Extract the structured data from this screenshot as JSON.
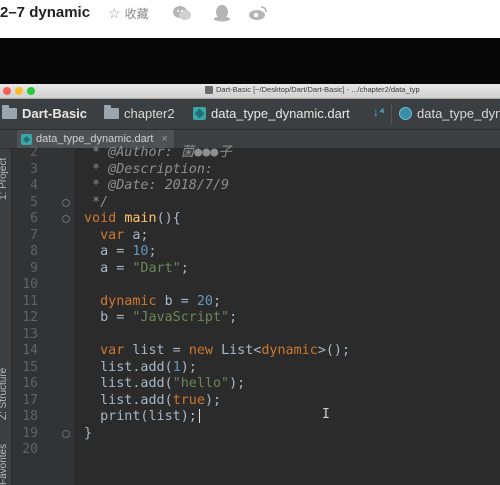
{
  "page": {
    "title": "2–7 dynamic",
    "favorite_label": "收藏",
    "share_icons": [
      "wechat-icon",
      "qq-icon",
      "weibo-icon"
    ]
  },
  "window": {
    "title": "Dart-Basic [~/Desktop/Dart/Dart-Basic] - .../chapter2/data_typ"
  },
  "navbar": {
    "project": "Dart-Basic",
    "folder": "chapter2",
    "file": "data_type_dynamic.dart",
    "symbol": "data_type_dyn"
  },
  "tab": {
    "label": "data_type_dynamic.dart",
    "close": "×"
  },
  "tool_windows": {
    "project": "1: Project",
    "structure": "Z: Structure",
    "favorites": "Favorites"
  },
  "editor": {
    "lines": [
      {
        "n": "2",
        "tokens": [
          {
            "t": " * @Author: ",
            "c": "c-comment"
          },
          {
            "t": "菌●●●子",
            "c": "c-comment"
          }
        ]
      },
      {
        "n": "3",
        "tokens": [
          {
            "t": " * @Description:",
            "c": "c-comment"
          }
        ]
      },
      {
        "n": "4",
        "tokens": [
          {
            "t": " * @Date: 2018/7/9",
            "c": "c-comment"
          }
        ]
      },
      {
        "n": "5",
        "tokens": [
          {
            "t": " */",
            "c": "c-comment"
          }
        ]
      },
      {
        "n": "6",
        "tokens": [
          {
            "t": "void ",
            "c": "c-kw"
          },
          {
            "t": "main",
            "c": "c-fn"
          },
          {
            "t": "(){",
            "c": "c-plain"
          }
        ]
      },
      {
        "n": "7",
        "tokens": [
          {
            "t": "  var ",
            "c": "c-kw"
          },
          {
            "t": "a;",
            "c": "c-plain"
          }
        ]
      },
      {
        "n": "8",
        "tokens": [
          {
            "t": "  a = ",
            "c": "c-plain"
          },
          {
            "t": "10",
            "c": "c-num"
          },
          {
            "t": ";",
            "c": "c-plain"
          }
        ]
      },
      {
        "n": "9",
        "tokens": [
          {
            "t": "  a = ",
            "c": "c-plain"
          },
          {
            "t": "\"Dart\"",
            "c": "c-str"
          },
          {
            "t": ";",
            "c": "c-plain"
          }
        ]
      },
      {
        "n": "10",
        "tokens": []
      },
      {
        "n": "11",
        "tokens": [
          {
            "t": "  dynamic ",
            "c": "c-kw"
          },
          {
            "t": "b = ",
            "c": "c-plain"
          },
          {
            "t": "20",
            "c": "c-num"
          },
          {
            "t": ";",
            "c": "c-plain"
          }
        ]
      },
      {
        "n": "12",
        "tokens": [
          {
            "t": "  b = ",
            "c": "c-plain"
          },
          {
            "t": "\"JavaScript\"",
            "c": "c-str"
          },
          {
            "t": ";",
            "c": "c-plain"
          }
        ]
      },
      {
        "n": "13",
        "tokens": []
      },
      {
        "n": "14",
        "tokens": [
          {
            "t": "  var ",
            "c": "c-kw"
          },
          {
            "t": "list = ",
            "c": "c-plain"
          },
          {
            "t": "new ",
            "c": "c-kw"
          },
          {
            "t": "List<",
            "c": "c-plain"
          },
          {
            "t": "dynamic",
            "c": "c-kw"
          },
          {
            "t": ">();",
            "c": "c-plain"
          }
        ]
      },
      {
        "n": "15",
        "tokens": [
          {
            "t": "  list.add(",
            "c": "c-plain"
          },
          {
            "t": "1",
            "c": "c-num"
          },
          {
            "t": ");",
            "c": "c-plain"
          }
        ]
      },
      {
        "n": "16",
        "tokens": [
          {
            "t": "  list.add(",
            "c": "c-plain"
          },
          {
            "t": "\"hello\"",
            "c": "c-str"
          },
          {
            "t": ");",
            "c": "c-plain"
          }
        ]
      },
      {
        "n": "17",
        "tokens": [
          {
            "t": "  list.add(",
            "c": "c-plain"
          },
          {
            "t": "true",
            "c": "c-kw"
          },
          {
            "t": ");",
            "c": "c-plain"
          }
        ]
      },
      {
        "n": "18",
        "tokens": [
          {
            "t": "  print(list);",
            "c": "c-plain"
          }
        ],
        "caret": true
      },
      {
        "n": "19",
        "tokens": [
          {
            "t": "}",
            "c": "c-plain"
          }
        ]
      },
      {
        "n": "20",
        "tokens": []
      }
    ],
    "pointer": "I"
  },
  "colors": {
    "editor_bg": "#2b2b2b",
    "keyword": "#cc7832",
    "string": "#6a8759",
    "number": "#6897bb",
    "function": "#ffc66d"
  }
}
